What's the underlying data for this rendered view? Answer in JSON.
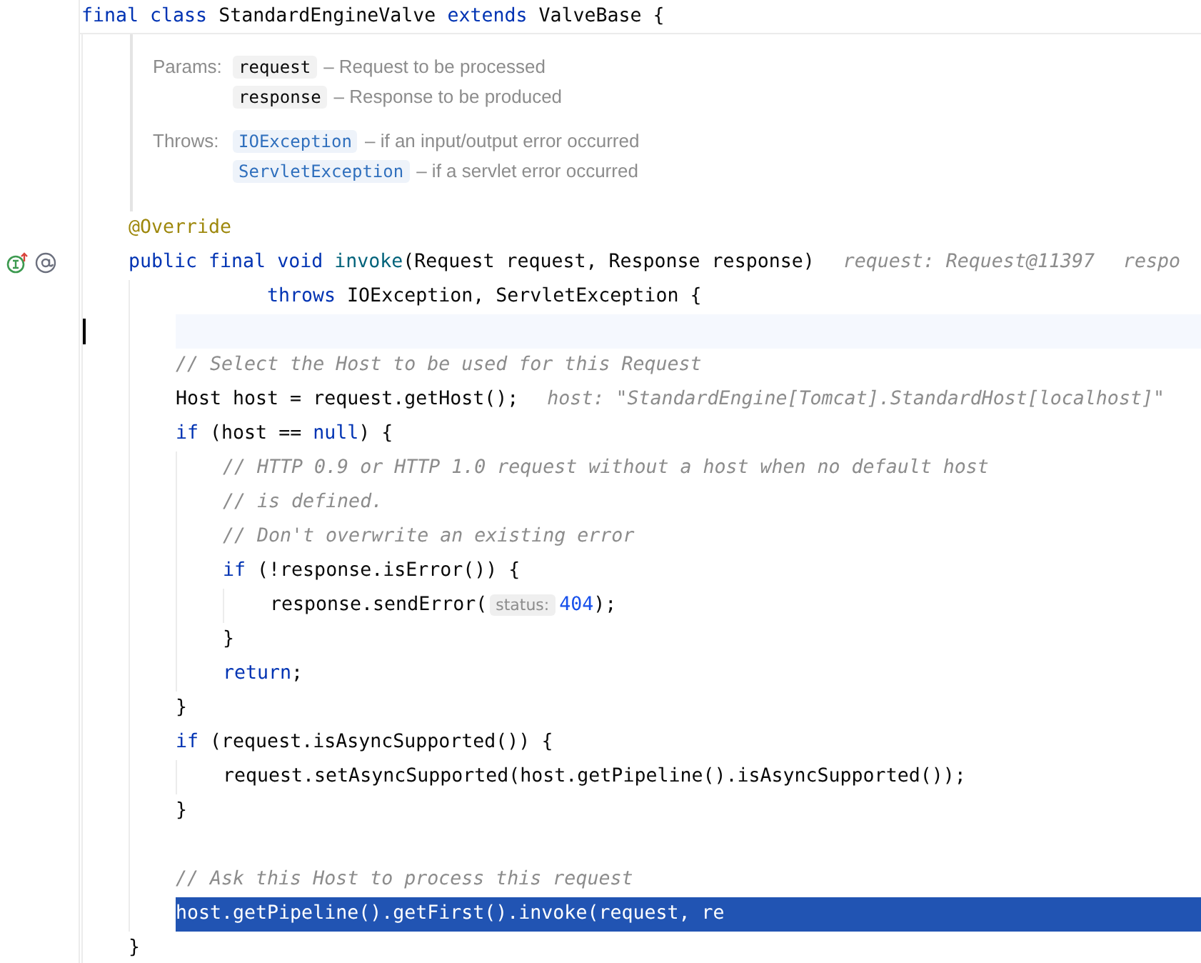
{
  "code": [
    {
      "kind": "code",
      "tokens": [
        {
          "kind": "kw",
          "text": "final class "
        },
        {
          "kind": "text",
          "text": "StandardEngineValve "
        },
        {
          "kind": "kw",
          "text": "extends "
        },
        {
          "kind": "text",
          "text": "ValveBase {"
        }
      ],
      "children": [
        {
          "kind": "doc",
          "sections": [
            {
              "label": "Params:",
              "entries": [
                {
                  "kind": "param",
                  "name": "request",
                  "description": "– Request to be processed"
                },
                {
                  "kind": "param",
                  "name": "response",
                  "description": "– Response to be produced"
                }
              ]
            },
            {
              "label": "Throws:",
              "entries": [
                {
                  "kind": "link",
                  "name": "IOException",
                  "description": "– if an input/output error occurred"
                },
                {
                  "kind": "link",
                  "name": "ServletException",
                  "description": "– if a servlet error occurred"
                }
              ]
            }
          ]
        },
        {
          "kind": "code",
          "tokens": [
            {
              "kind": "annotation",
              "text": "@Override"
            }
          ]
        },
        {
          "kind": "code",
          "override_marker": true,
          "tokens": [
            {
              "kind": "kw",
              "text": "public final void "
            },
            {
              "kind": "method",
              "text": "invoke"
            },
            {
              "kind": "text",
              "text": "(Request request, Response response)"
            },
            {
              "kind": "hint",
              "text": "request: Request@11397"
            },
            {
              "kind": "hint",
              "text": "respo"
            }
          ],
          "children": [
            {
              "kind": "continuation",
              "tokens": [
                {
                  "kind": "kw",
                  "text": "throws "
                },
                {
                  "kind": "text",
                  "text": "IOException, ServletException {"
                }
              ]
            },
            {
              "kind": "blank",
              "caret_line": true
            },
            {
              "kind": "code",
              "tokens": [
                {
                  "kind": "comment",
                  "text": "// Select the Host to be used for this Request"
                }
              ]
            },
            {
              "kind": "code",
              "tokens": [
                {
                  "kind": "text",
                  "text": "Host host = request.getHost();"
                },
                {
                  "kind": "hint",
                  "text": "host: \"StandardEngine[Tomcat].StandardHost[localhost]\""
                }
              ]
            },
            {
              "kind": "code",
              "tokens": [
                {
                  "kind": "kw",
                  "text": "if "
                },
                {
                  "kind": "text",
                  "text": "(host == "
                },
                {
                  "kind": "kw",
                  "text": "null"
                },
                {
                  "kind": "text",
                  "text": ") {"
                }
              ],
              "children": [
                {
                  "kind": "code",
                  "tokens": [
                    {
                      "kind": "comment",
                      "text": "// HTTP 0.9 or HTTP 1.0 request without a host when no default host"
                    }
                  ]
                },
                {
                  "kind": "code",
                  "tokens": [
                    {
                      "kind": "comment",
                      "text": "// is defined."
                    }
                  ]
                },
                {
                  "kind": "code",
                  "tokens": [
                    {
                      "kind": "comment",
                      "text": "// Don't overwrite an existing error"
                    }
                  ]
                },
                {
                  "kind": "code",
                  "tokens": [
                    {
                      "kind": "kw",
                      "text": "if "
                    },
                    {
                      "kind": "text",
                      "text": "(!response.isError()) {"
                    }
                  ],
                  "children": [
                    {
                      "kind": "code",
                      "tokens": [
                        {
                          "kind": "text",
                          "text": "response.sendError("
                        },
                        {
                          "kind": "param_hint",
                          "text": "status:"
                        },
                        {
                          "kind": "number",
                          "text": "404"
                        },
                        {
                          "kind": "text",
                          "text": ");"
                        }
                      ]
                    }
                  ]
                },
                {
                  "kind": "code",
                  "tokens": [
                    {
                      "kind": "text",
                      "text": "}"
                    }
                  ]
                },
                {
                  "kind": "code",
                  "tokens": [
                    {
                      "kind": "kw",
                      "text": "return"
                    },
                    {
                      "kind": "text",
                      "text": ";"
                    }
                  ]
                }
              ]
            },
            {
              "kind": "code",
              "tokens": [
                {
                  "kind": "text",
                  "text": "}"
                }
              ]
            },
            {
              "kind": "code",
              "tokens": [
                {
                  "kind": "kw",
                  "text": "if "
                },
                {
                  "kind": "text",
                  "text": "(request.isAsyncSupported()) {"
                }
              ],
              "children": [
                {
                  "kind": "code",
                  "tokens": [
                    {
                      "kind": "text",
                      "text": "request.setAsyncSupported(host.getPipeline().isAsyncSupported());"
                    }
                  ]
                }
              ]
            },
            {
              "kind": "code",
              "tokens": [
                {
                  "kind": "text",
                  "text": "}"
                }
              ]
            },
            {
              "kind": "blank"
            },
            {
              "kind": "code",
              "tokens": [
                {
                  "kind": "comment",
                  "text": "// Ask this Host to process this request"
                }
              ]
            },
            {
              "kind": "code",
              "execution_point": true,
              "tokens": [
                {
                  "kind": "text",
                  "text": "host.getPipeline().getFirst().invoke(request, re"
                }
              ]
            }
          ]
        },
        {
          "kind": "code",
          "tokens": [
            {
              "kind": "text",
              "text": "}"
            }
          ]
        }
      ]
    }
  ]
}
